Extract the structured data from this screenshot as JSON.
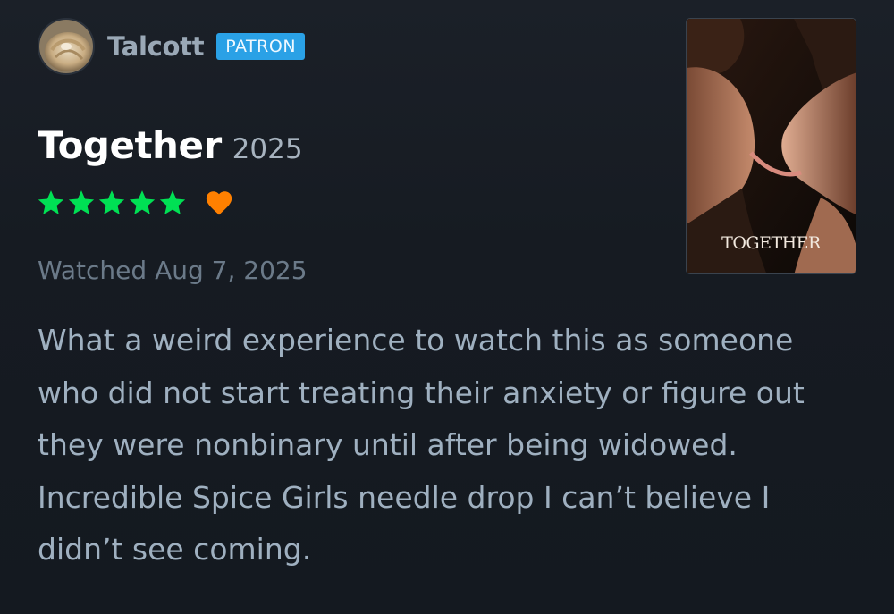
{
  "user": {
    "name": "Talcott",
    "badge": "PATRON"
  },
  "film": {
    "title": "Together",
    "year": "2025",
    "poster_caption": "TOGETHER"
  },
  "rating": {
    "stars": 5,
    "max_stars": 5,
    "liked": true,
    "star_color": "#00e054",
    "heart_color": "#ff8000"
  },
  "watched": "Watched Aug 7, 2025",
  "review": "What a weird experience to watch this as someone who did not start treating their anxiety or figure out they were nonbinary until after being widowed. Incredible Spice Girls needle drop I can’t believe I didn’t see coming.",
  "colors": {
    "background": "#161b22",
    "badge": "#2aa1e6"
  }
}
